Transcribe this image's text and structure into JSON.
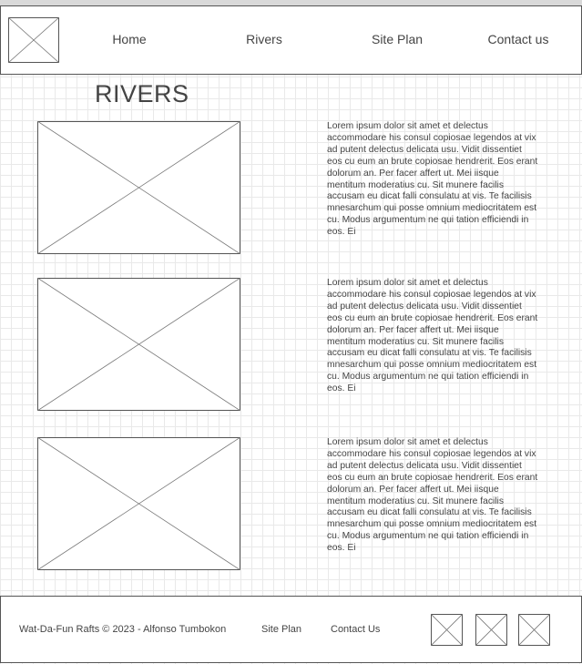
{
  "header": {
    "logo": "image-placeholder-icon",
    "nav": [
      {
        "label": "Home"
      },
      {
        "label": "Rivers"
      },
      {
        "label": "Site Plan"
      },
      {
        "label": "Contact us"
      }
    ]
  },
  "main": {
    "title": "RIVERS",
    "rows": [
      {
        "image": "image-placeholder-icon",
        "text": "Lorem ipsum dolor sit amet et delectus accommodare his consul copiosae legendos at vix ad putent delectus delicata usu. Vidit dissentiet eos cu eum an brute copiosae hendrerit. Eos erant dolorum an. Per facer affert ut. Mei iisque mentitum moderatius cu. Sit munere facilis accusam eu dicat falli consulatu at vis. Te facilisis mnesarchum qui posse omnium mediocritatem est cu. Modus argumentum ne qui tation efficiendi in eos. Ei"
      },
      {
        "image": "image-placeholder-icon",
        "text": "Lorem ipsum dolor sit amet et delectus accommodare his consul copiosae legendos at vix ad putent delectus delicata usu. Vidit dissentiet eos cu eum an brute copiosae hendrerit. Eos erant dolorum an. Per facer affert ut. Mei iisque mentitum moderatius cu. Sit munere facilis accusam eu dicat falli consulatu at vis. Te facilisis mnesarchum qui posse omnium mediocritatem est cu. Modus argumentum ne qui tation efficiendi in eos. Ei"
      },
      {
        "image": "image-placeholder-icon",
        "text": "Lorem ipsum dolor sit amet et delectus accommodare his consul copiosae legendos at vix ad putent delectus delicata usu. Vidit dissentiet eos cu eum an brute copiosae hendrerit. Eos erant dolorum an. Per facer affert ut. Mei iisque mentitum moderatius cu. Sit munere facilis accusam eu dicat falli consulatu at vis. Te facilisis mnesarchum qui posse omnium mediocritatem est cu. Modus argumentum ne qui tation efficiendi in eos. Ei"
      }
    ]
  },
  "footer": {
    "copyright": "Wat-Da-Fun Rafts © 2023 - Alfonso Tumbokon",
    "site_plan": "Site Plan",
    "contact": "Contact Us",
    "social_icons": [
      "image-placeholder-icon",
      "image-placeholder-icon",
      "image-placeholder-icon"
    ]
  },
  "colors": {
    "border": "#555555",
    "text": "#444444",
    "grid": "#e9e9e9"
  }
}
